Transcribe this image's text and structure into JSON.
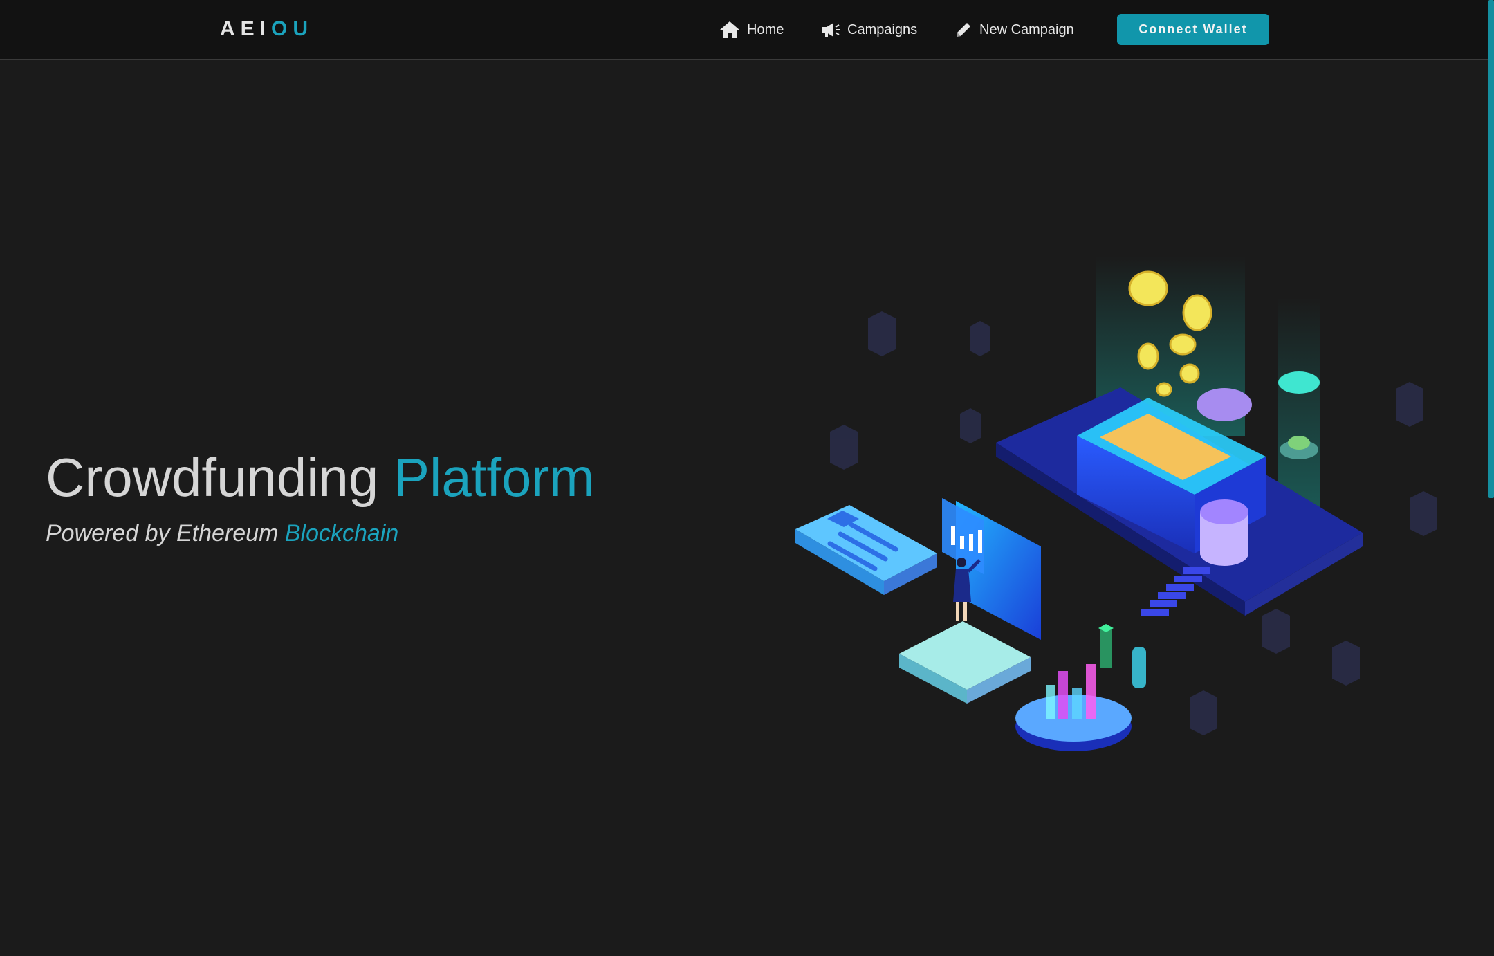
{
  "brand": {
    "logo_part1": "AEI",
    "logo_part2": "OU"
  },
  "nav": {
    "items": [
      {
        "label": "Home",
        "icon": "home-icon"
      },
      {
        "label": "Campaigns",
        "icon": "megaphone-icon"
      },
      {
        "label": "New Campaign",
        "icon": "pencil-icon"
      }
    ],
    "connect_label": "Connect Wallet"
  },
  "hero": {
    "title_main": "Crowdfunding",
    "title_accent": "Platform",
    "subtitle_main": "Powered by Ethereum",
    "subtitle_accent": "Blockchain"
  },
  "colors": {
    "background": "#1b1b1b",
    "navbar": "#121212",
    "accent": "#1ba3bd",
    "button": "#1196ab",
    "text": "#d6d6d6"
  }
}
